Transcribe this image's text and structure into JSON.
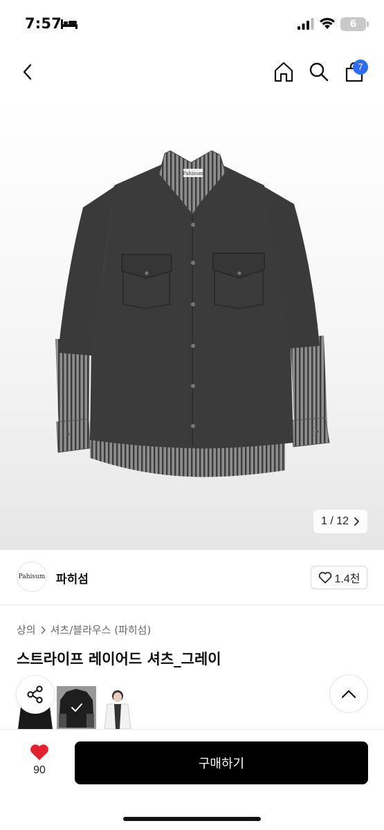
{
  "status_bar": {
    "time": "7:57",
    "battery_level": "6",
    "icons": [
      "bed-icon",
      "signal-icon",
      "wifi-icon",
      "battery-icon"
    ]
  },
  "nav": {
    "icons": [
      "chevron-left-icon",
      "home-icon",
      "search-icon",
      "cart-icon"
    ],
    "cart_count": "7"
  },
  "gallery": {
    "current": "1",
    "separator": "/",
    "total": "12",
    "counter_text": "1 / 12",
    "image_label_text": "Pahisum"
  },
  "brand": {
    "logo_text": "Pahisum",
    "name": "파히섬",
    "follow_count": "1.4천"
  },
  "product": {
    "breadcrumb": [
      "상의",
      "셔츠/블라우스 (파히섬)"
    ],
    "title": "스트라이프 레이어드 셔츠_그레이"
  },
  "thumbnails": [
    {
      "name": "black-variant",
      "selected": false
    },
    {
      "name": "gray-variant",
      "selected": true
    },
    {
      "name": "model-variant",
      "selected": false
    }
  ],
  "bottom_bar": {
    "like_count": "90",
    "buy_label": "구매하기"
  },
  "colors": {
    "accent": "#2d6df6",
    "like": "#e5202e",
    "buy_button": "#000000"
  }
}
